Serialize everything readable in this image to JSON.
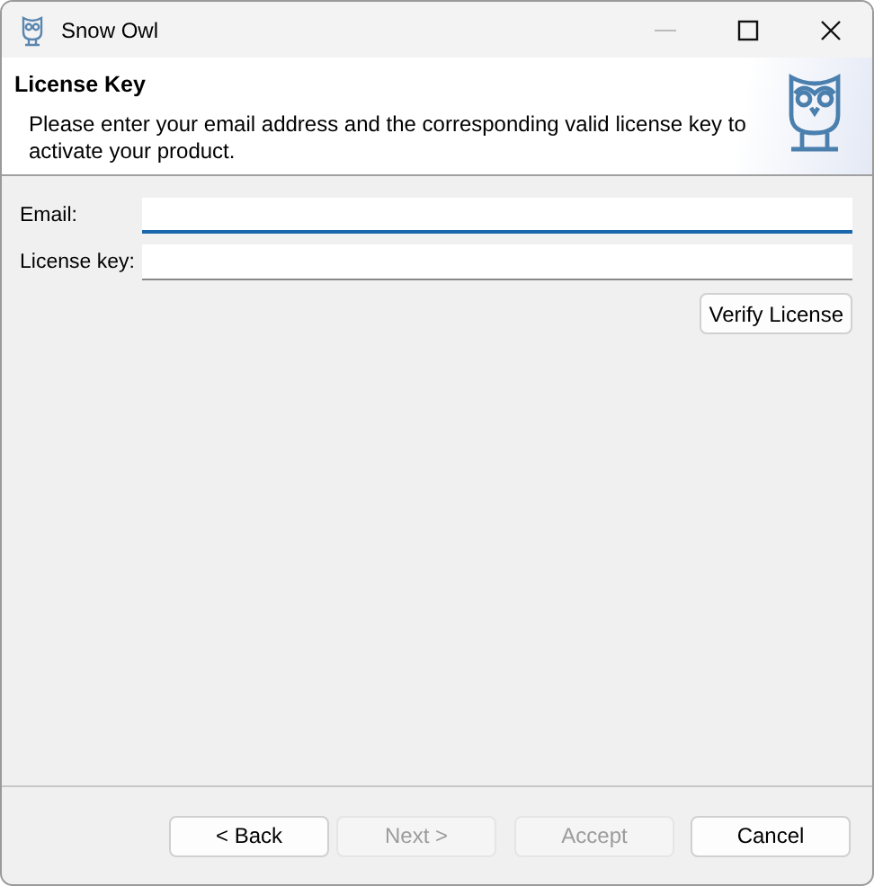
{
  "window": {
    "title": "Snow Owl"
  },
  "header": {
    "title": "License Key",
    "description": "Please enter your email address and the corresponding valid license key to activate your product."
  },
  "fields": [
    {
      "label": "Email:",
      "focused": true
    },
    {
      "label": "License key:",
      "focused": false
    }
  ],
  "verify_button": {
    "label": "Verify License",
    "disabled": false
  },
  "buttons": [
    {
      "label": "< Back",
      "disabled": false
    },
    {
      "label": "Next >",
      "disabled": true
    },
    {
      "label": "Accept",
      "disabled": true
    },
    {
      "label": "Cancel",
      "disabled": false
    }
  ]
}
